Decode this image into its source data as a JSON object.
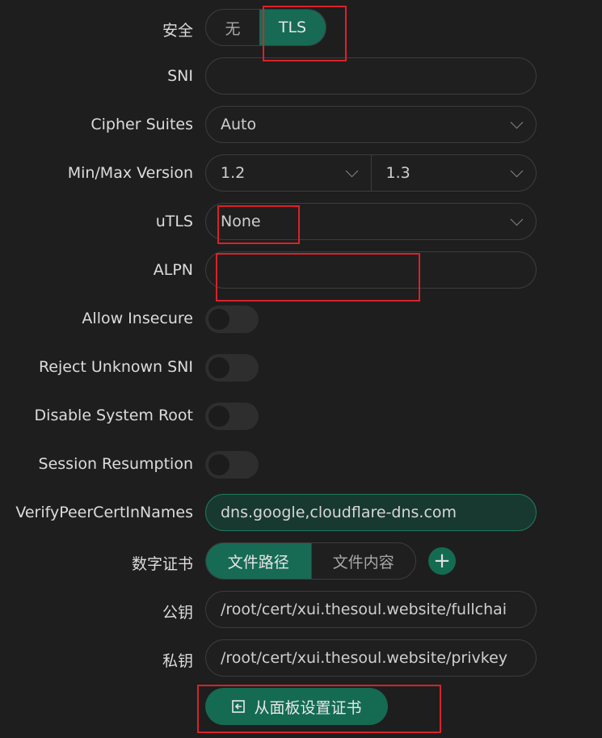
{
  "rows": {
    "security": {
      "label": "安全",
      "options": [
        "无",
        "TLS"
      ],
      "selected": "TLS"
    },
    "sni": {
      "label": "SNI",
      "value": ""
    },
    "cipher_suites": {
      "label": "Cipher Suites",
      "value": "Auto"
    },
    "min_max_version": {
      "label": "Min/Max Version",
      "min": "1.2",
      "max": "1.3"
    },
    "utls": {
      "label": "uTLS",
      "value": "None"
    },
    "alpn": {
      "label": "ALPN",
      "value": ""
    },
    "allow_insecure": {
      "label": "Allow Insecure",
      "on": false
    },
    "reject_unknown_sni": {
      "label": "Reject Unknown SNI",
      "on": false
    },
    "disable_system_root": {
      "label": "Disable System Root",
      "on": false
    },
    "session_resumption": {
      "label": "Session Resumption",
      "on": false
    },
    "verify_peer": {
      "label": "VerifyPeerCertInNames",
      "value": "dns.google,cloudflare-dns.com"
    },
    "certificate": {
      "label": "数字证书",
      "options": [
        "文件路径",
        "文件内容"
      ],
      "selected": "文件路径",
      "add": "+"
    },
    "public_key": {
      "label": "公钥",
      "value": "/root/cert/xui.thesoul.website/fullchai"
    },
    "private_key": {
      "label": "私钥",
      "value": "/root/cert/xui.thesoul.website/privkey"
    }
  },
  "set_cert_button": {
    "label": "从面板设置证书"
  },
  "colors": {
    "accent": "#146b52",
    "highlight": "#d9222a",
    "background": "#1e1e1e"
  }
}
